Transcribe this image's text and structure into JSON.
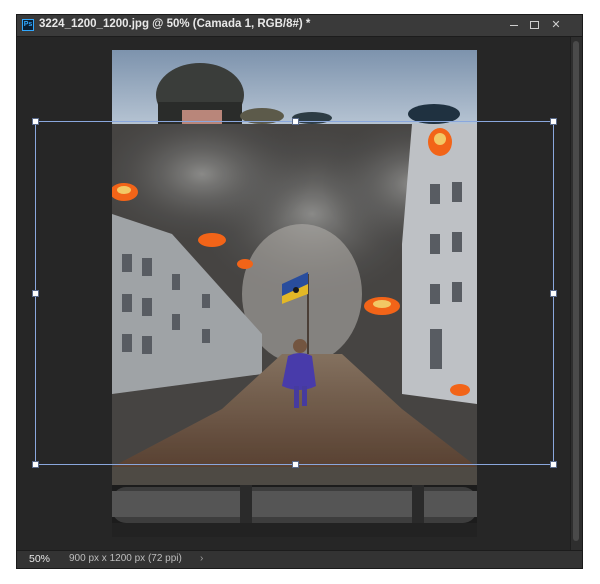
{
  "window": {
    "title": "3224_1200_1200.jpg @ 50% (Camada 1, RGB/8#) *",
    "app_icon_label": "Ps"
  },
  "status": {
    "zoom": "50%",
    "doc_info": "900 px x 1200 px (72 ppi)",
    "arrow": "›"
  },
  "colors": {
    "workspace": "#262626",
    "titlebar": "#3a3a3a",
    "transform_box": "#8aa7dd"
  }
}
